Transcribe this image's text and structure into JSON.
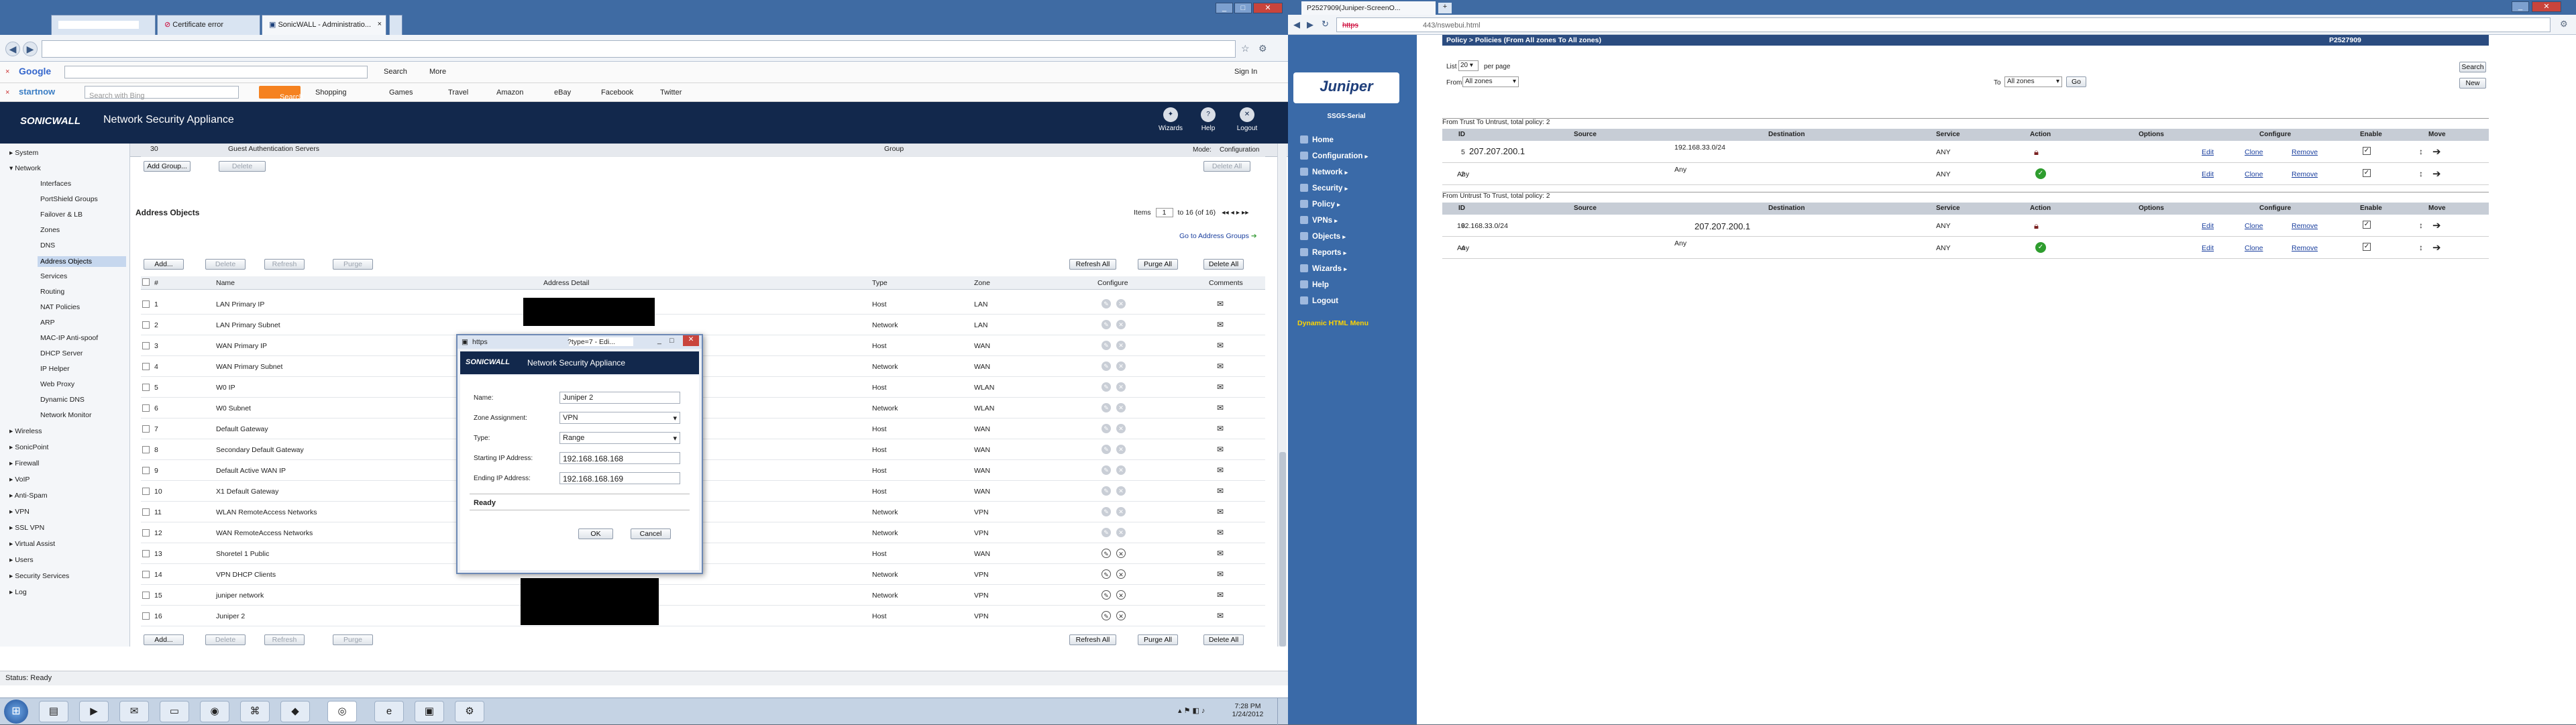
{
  "left_window": {
    "tabs": [
      {
        "label": "",
        "redacted": true
      },
      {
        "label": "Certificate error"
      },
      {
        "label": "SonicWALL - Administratio..."
      }
    ],
    "address_bar_url": "",
    "google_bar": {
      "logo": "Google",
      "search_label": "Search",
      "more_label": "More",
      "sign_in": "Sign In"
    },
    "startnow_bar": {
      "logo": "startnow",
      "search_placeholder": "Search with Bing",
      "search_button": "Search",
      "links": [
        "Shopping",
        "Games",
        "Travel",
        "Amazon",
        "eBay",
        "Facebook",
        "Twitter"
      ]
    },
    "sonicwall": {
      "logo": "SONICWALL",
      "title": "Network Security Appliance",
      "top_buttons": [
        "Wizards",
        "Help",
        "Logout"
      ],
      "mode_label": "Mode:",
      "mode_value": "Configuration",
      "sidebar": {
        "groups": [
          "System",
          "Network",
          "Wireless",
          "SonicPoint",
          "Firewall",
          "VoIP",
          "Anti-Spam",
          "VPN",
          "SSL VPN",
          "Virtual Assist",
          "Users",
          "Security Services",
          "Log"
        ],
        "network_items": [
          "Interfaces",
          "PortShield Groups",
          "Failover & LB",
          "Zones",
          "DNS",
          "Address Objects",
          "Services",
          "Routing",
          "NAT Policies",
          "ARP",
          "MAC-IP Anti-spoof",
          "DHCP Server",
          "IP Helper",
          "Web Proxy",
          "Dynamic DNS",
          "Network Monitor"
        ],
        "selected": "Address Objects"
      },
      "groups_toolbar": {
        "add_group": "Add Group...",
        "delete": "Delete",
        "delete_all": "Delete All"
      },
      "partial_row": {
        "num": "30",
        "name": "Guest Authentication Servers",
        "type": "Group"
      },
      "section_title": "Address Objects",
      "items_label": "Items",
      "items_value": "1",
      "items_of": "to 16 (of 16)",
      "go_to_groups": "Go to Address Groups",
      "toolbar": {
        "add": "Add...",
        "delete": "Delete",
        "refresh": "Refresh",
        "purge": "Purge",
        "refresh_all": "Refresh All",
        "purge_all": "Purge All",
        "delete_all": "Delete All"
      },
      "columns": [
        "#",
        "Name",
        "Address Detail",
        "Type",
        "Zone",
        "Configure",
        "Comments"
      ],
      "rows": [
        {
          "num": "1",
          "name": "LAN Primary IP",
          "type": "Host",
          "zone": "LAN"
        },
        {
          "num": "2",
          "name": "LAN Primary Subnet",
          "type": "Network",
          "zone": "LAN"
        },
        {
          "num": "3",
          "name": "WAN Primary IP",
          "type": "Host",
          "zone": "WAN"
        },
        {
          "num": "4",
          "name": "WAN Primary Subnet",
          "type": "Network",
          "zone": "WAN"
        },
        {
          "num": "5",
          "name": "W0 IP",
          "type": "Host",
          "zone": "WLAN"
        },
        {
          "num": "6",
          "name": "W0 Subnet",
          "type": "Network",
          "zone": "WLAN"
        },
        {
          "num": "7",
          "name": "Default Gateway",
          "type": "Host",
          "zone": "WAN"
        },
        {
          "num": "8",
          "name": "Secondary Default Gateway",
          "type": "Host",
          "zone": "WAN"
        },
        {
          "num": "9",
          "name": "Default Active WAN IP",
          "type": "Host",
          "zone": "WAN"
        },
        {
          "num": "10",
          "name": "X1 Default Gateway",
          "type": "Host",
          "zone": "WAN"
        },
        {
          "num": "11",
          "name": "WLAN RemoteAccess Networks",
          "type": "Network",
          "zone": "VPN"
        },
        {
          "num": "12",
          "name": "WAN RemoteAccess Networks",
          "type": "Network",
          "zone": "VPN"
        },
        {
          "num": "13",
          "name": "Shoretel 1 Public",
          "type": "Host",
          "zone": "WAN"
        },
        {
          "num": "14",
          "name": "VPN DHCP Clients",
          "type": "Network",
          "zone": "VPN"
        },
        {
          "num": "15",
          "name": "juniper network",
          "type": "Network",
          "zone": "VPN"
        },
        {
          "num": "16",
          "name": "Juniper 2",
          "type": "Host",
          "zone": "VPN"
        }
      ],
      "status": "Status: Ready"
    },
    "dialog": {
      "title": "https",
      "title_right": "?type=7 - Edi...",
      "header": "Network Security Appliance",
      "name_label": "Name:",
      "name_value": "Juniper 2",
      "zone_label": "Zone Assignment:",
      "zone_value": "VPN",
      "type_label": "Type:",
      "type_value": "Range",
      "start_label": "Starting IP Address:",
      "start_value": "192.168.168.168",
      "end_label": "Ending IP Address:",
      "end_value": "192.168.168.169",
      "status": "Ready",
      "ok": "OK",
      "cancel": "Cancel"
    },
    "taskbar": {
      "time": "7:28 PM",
      "date": "1/24/2012"
    }
  },
  "right_window": {
    "tab_label": "P2527909(Juniper-ScreenO...",
    "url_prefix": "https",
    "url": "443/nswebui.html",
    "page_path": "Policy > Policies (From All zones To All zones)",
    "device_id": "P2527909",
    "list_label": "List",
    "list_value": "20",
    "per_page": "per page",
    "from_label": "From",
    "from_value": "All zones",
    "to_label": "To",
    "to_value": "All zones",
    "go": "Go",
    "search": "Search",
    "new": "New",
    "brand": "Juniper",
    "brand_sub": "SSG5-Serial",
    "menu": [
      "Home",
      "Configuration",
      "Network",
      "Security",
      "Policy",
      "VPNs",
      "Objects",
      "Reports",
      "Wizards",
      "Help",
      "Logout"
    ],
    "dynamic_menu": "Dynamic HTML Menu",
    "columns": [
      "ID",
      "Source",
      "Destination",
      "Service",
      "Action",
      "Options",
      "Configure",
      "Enable",
      "Move"
    ],
    "sections": [
      {
        "title": "From Trust To Untrust, total policy: 2",
        "rows": [
          {
            "id": "5",
            "source": "207.207.200.1",
            "destination": "192.168.33.0/24",
            "service": "ANY",
            "action": "tunnel",
            "edit": "Edit",
            "clone": "Clone",
            "remove": "Remove"
          },
          {
            "id": "2",
            "source": "Any",
            "destination": "Any",
            "service": "ANY",
            "action": "permit",
            "edit": "Edit",
            "clone": "Clone",
            "remove": "Remove"
          }
        ]
      },
      {
        "title": "From Untrust To Trust, total policy: 2",
        "rows": [
          {
            "id": "6",
            "source": "192.168.33.0/24",
            "destination": "207.207.200.1",
            "service": "ANY",
            "action": "tunnel",
            "edit": "Edit",
            "clone": "Clone",
            "remove": "Remove"
          },
          {
            "id": "4",
            "source": "Any",
            "destination": "Any",
            "service": "ANY",
            "action": "permit",
            "edit": "Edit",
            "clone": "Clone",
            "remove": "Remove"
          }
        ]
      }
    ]
  },
  "colors": {
    "sonicwall_header": "#12284c",
    "juniper_nav": "#2d5596",
    "chrome_frame": "#3f6ba3",
    "startnow_orange": "#f58220"
  }
}
